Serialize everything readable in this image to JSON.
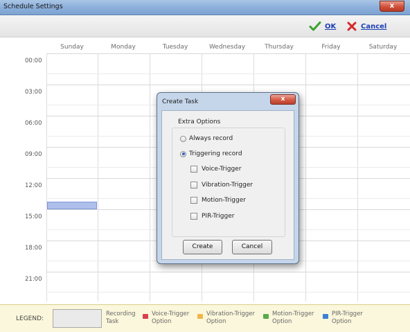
{
  "window": {
    "title": "Schedule Settings",
    "close_label": "x"
  },
  "toolbar": {
    "ok_label": "OK",
    "cancel_label": "Cancel"
  },
  "calendar": {
    "days": [
      "Sunday",
      "Monday",
      "Tuesday",
      "Wednesday",
      "Thursday",
      "Friday",
      "Saturday"
    ],
    "times": [
      "00:00",
      "03:00",
      "06:00",
      "09:00",
      "12:00",
      "15:00",
      "18:00",
      "21:00"
    ]
  },
  "legend": {
    "title": "LEGEND:",
    "items": [
      {
        "label_line1": "Recording",
        "label_line2": "Task",
        "color": ""
      },
      {
        "label_line1": "Voice-Trigger",
        "label_line2": "Option",
        "color": "#d9414e"
      },
      {
        "label_line1": "Vibration-Trigger",
        "label_line2": "Option",
        "color": "#f0b64a"
      },
      {
        "label_line1": "Motion-Trigger",
        "label_line2": "Option",
        "color": "#5aaa4e"
      },
      {
        "label_line1": "PIR-Trigger",
        "label_line2": "Option",
        "color": "#3c7fd6"
      }
    ]
  },
  "dialog": {
    "title": "Create Task",
    "close_label": "x",
    "group_title": "Extra Options",
    "radio_always": "Always record",
    "radio_triggering": "Triggering record",
    "selected_mode": "Triggering record",
    "checkboxes": [
      "Voice-Trigger",
      "Vibration-Trigger",
      "Motion-Trigger",
      "PIR-Trigger"
    ],
    "create_label": "Create",
    "cancel_label": "Cancel"
  },
  "colors": {
    "accent_link": "#1c3fb4",
    "ok_check": "#3aa130",
    "cancel_x": "#d42a2a",
    "selection": "#aebfec"
  }
}
